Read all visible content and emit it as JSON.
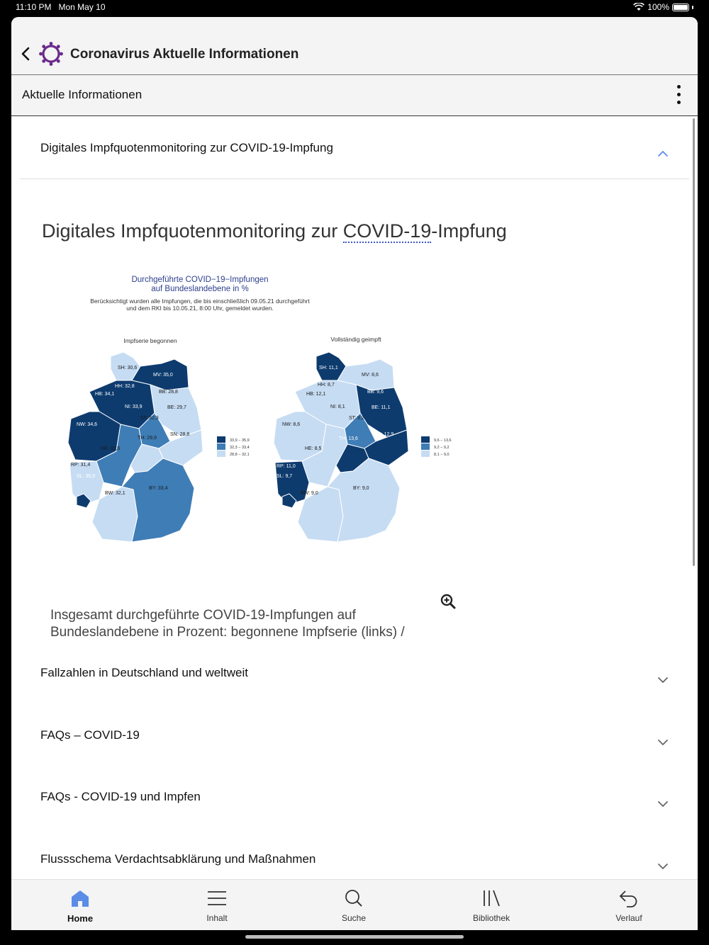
{
  "status_bar": {
    "time": "11:10 PM",
    "date": "Mon May 10",
    "battery": "100%"
  },
  "header": {
    "title": "Coronavirus Aktuelle Informationen"
  },
  "subheader": {
    "title": "Aktuelle Informationen"
  },
  "open_section": {
    "title": "Digitales Impfquotenmonitoring zur COVID-19-Impfung"
  },
  "article": {
    "heading_pre": "Digitales Impfquotenmonitoring zur ",
    "heading_abbr": "COVID-19",
    "heading_post": "-Impfung",
    "caption": "Insgesamt durchgeführte COVID-19-Impfungen auf Bundeslandebene in Prozent: begonnene Impfserie (links) /"
  },
  "figure": {
    "title_line1": "Durchgeführte COVID−19−Impfungen",
    "title_line2": "auf Bundeslandebene in %",
    "note_line1": "Berücksichtigt wurden alle Impfungen, die bis einschließlich 09.05.21 durchgeführt",
    "note_line2": "und dem RKI bis 10.05.21, 8:00 Uhr, gemeldet wurden.",
    "left_map_title": "Impfserie begonnen",
    "right_map_title": "Vollständig geimpft",
    "left_legend": [
      "33,9 − 35,9",
      "32,3 − 33,4",
      "28,8 − 32,1"
    ],
    "right_legend": [
      "9,6 − 13,6",
      "9,2 − 9,2",
      "8,1 − 9,0"
    ],
    "left_labels": [
      "SH: 30,6",
      "MV: 35,0",
      "HH: 32,8",
      "HB: 34,1",
      "BB: 28,8",
      "NI: 33,9",
      "BE: 29,7",
      "NW: 34,6",
      "ST: 32,3",
      "TH: 29,9",
      "SN: 28,8",
      "HE: 32,6",
      "RP: 31,4",
      "SL: 36,9",
      "BW: 32,1",
      "BY: 33,4"
    ],
    "right_labels": [
      "SH: 11,1",
      "MV: 8,6",
      "HH: 8,7",
      "HB: 12,1",
      "BB: 9,6",
      "NI: 8,1",
      "BE: 11,1",
      "NW: 8,6",
      "ST: 9,2",
      "TH: 13,6",
      "SN: 12,9",
      "HE: 8,5",
      "RP: 11,0",
      "SL: 9,7",
      "BW: 9,0",
      "BY: 9,0"
    ],
    "colors": {
      "dark": "#0d3b6e",
      "mid": "#3f7db6",
      "light": "#c6dcf3"
    }
  },
  "sections": [
    {
      "title": "Fallzahlen in Deutschland und weltweit"
    },
    {
      "title": "FAQs – COVID-19"
    },
    {
      "title": "FAQs - COVID-19 und Impfen"
    },
    {
      "title": "Flussschema Verdachtsabklärung und Maßnahmen"
    }
  ],
  "tabs": [
    {
      "label": "Home",
      "icon": "home-icon"
    },
    {
      "label": "Inhalt",
      "icon": "menu-icon"
    },
    {
      "label": "Suche",
      "icon": "search-icon"
    },
    {
      "label": "Bibliothek",
      "icon": "library-icon"
    },
    {
      "label": "Verlauf",
      "icon": "undo-icon"
    }
  ],
  "accent_color": "#5b8de6",
  "logo_color": "#6b2a8c"
}
